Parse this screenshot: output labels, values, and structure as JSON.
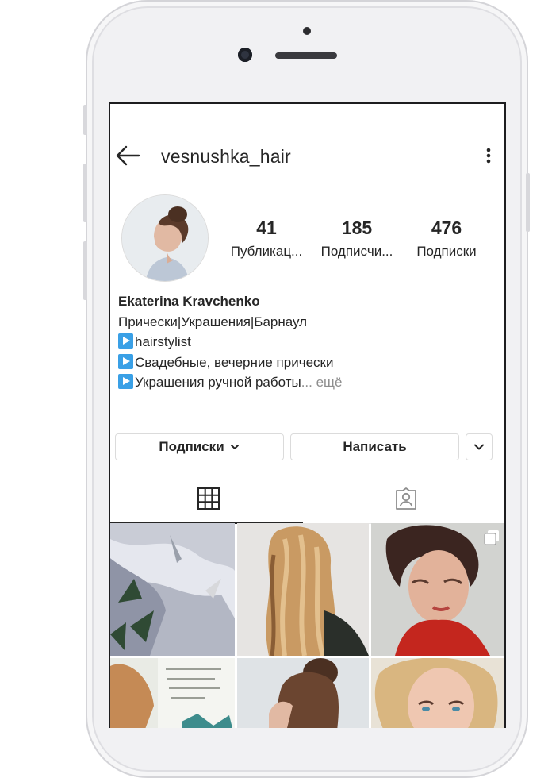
{
  "header": {
    "username": "vesnushka_hair",
    "back_icon": "arrow-left-icon",
    "more_icon": "vertical-dots-icon"
  },
  "stats": [
    {
      "value": "41",
      "label": "Публикац..."
    },
    {
      "value": "185",
      "label": "Подписчи..."
    },
    {
      "value": "476",
      "label": "Подписки"
    }
  ],
  "bio": {
    "name": "Ekaterina Kravchenko",
    "line1": "Прически|Украшения|Барнаул",
    "line2": "hairstylist",
    "line3": "Свадебные, вечерние прически",
    "line4": "Украшения ручной работы",
    "ellipsis": "...",
    "more": " ещё"
  },
  "actions": {
    "following_label": "Подписки",
    "message_label": "Написать"
  },
  "tabs": {
    "grid_icon": "grid-icon",
    "tagged_icon": "tagged-person-icon"
  },
  "colors": {
    "text": "#262626",
    "secondary": "#8e8e8e",
    "border": "#dbdbdb",
    "emoji_blue": "#3aa0e6"
  }
}
